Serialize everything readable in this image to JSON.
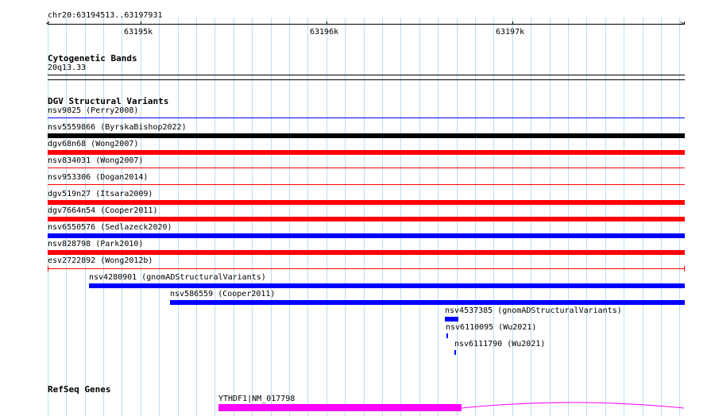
{
  "ruler": {
    "locus": "chr20:63194513..63197931",
    "ticks": [
      "63195k",
      "63196k",
      "63197k"
    ]
  },
  "cytoband": {
    "title": "Cytogenetic Bands",
    "band": "20q13.33"
  },
  "dgv": {
    "title": "DGV Structural Variants",
    "items": [
      {
        "label": "nsv9825 (Perry2008)",
        "color": "#0000ff"
      },
      {
        "label": "nsv5559866 (ByrskaBishop2022)",
        "color": "#000000"
      },
      {
        "label": "dgv68n68 (Wong2007)",
        "color": "#ff0000"
      },
      {
        "label": "nsv834031 (Wong2007)",
        "color": "#ff0000"
      },
      {
        "label": "nsv953306 (Dogan2014)",
        "color": "#ff0000"
      },
      {
        "label": "dgv519n27 (Itsara2009)",
        "color": "#ff0000"
      },
      {
        "label": "dgv7664n54 (Cooper2011)",
        "color": "#ff0000"
      },
      {
        "label": "nsv6550576 (Sedlazeck2020)",
        "color": "#0000ff"
      },
      {
        "label": "nsv828798 (Park2010)",
        "color": "#ff0000"
      },
      {
        "label": "esv2722892 (Wong2012b)",
        "color": "#ff0000"
      },
      {
        "label": "nsv4280901 (gnomADStructuralVariants)",
        "color": "#0000ff"
      },
      {
        "label": "nsv586559 (Cooper2011)",
        "color": "#0000ff"
      },
      {
        "label": "nsv4537385 (gnomADStructuralVariants)",
        "color": "#0000ff"
      },
      {
        "label": "nsv6110095 (Wu2021)",
        "color": "#0000ff"
      },
      {
        "label": "nsv6111790 (Wu2021)",
        "color": "#0000ff"
      }
    ]
  },
  "refseq": {
    "title": "RefSeq Genes",
    "gene_label": "YTHDF1|NM_017798",
    "color": "#ff00ff"
  }
}
